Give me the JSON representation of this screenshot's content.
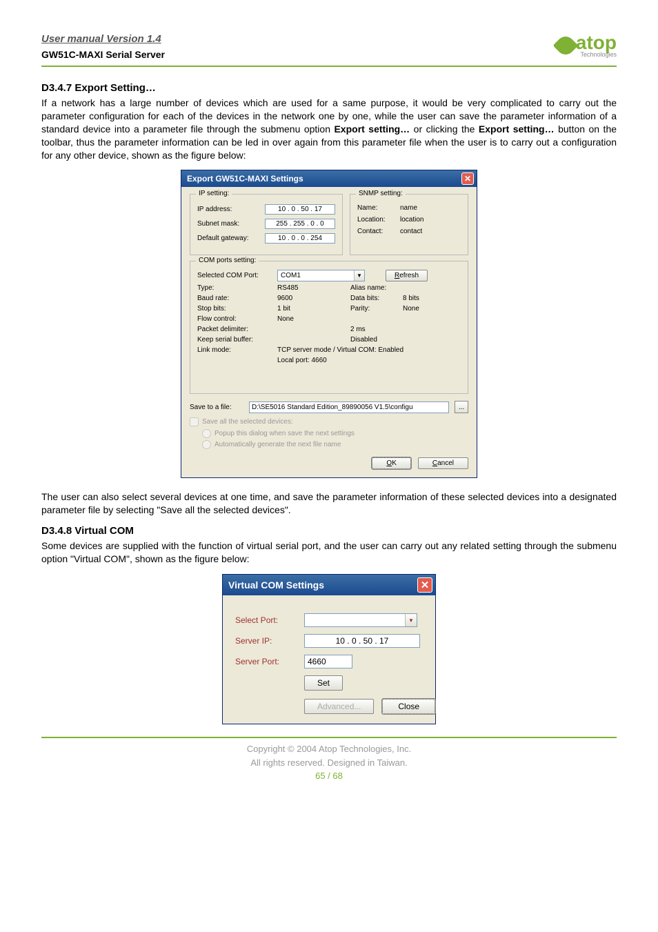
{
  "header": {
    "manual_title": "User manual Version 1.4",
    "product": "GW51C-MAXI Serial Server",
    "logo_text": "atop",
    "logo_sub": "Technologies"
  },
  "section1": {
    "heading": "D3.4.7 Export Setting…",
    "para_a": "If a network has a large number of devices which are used for a same purpose, it would be very complicated to carry out the parameter configuration for each of the devices in the network one by one, while the user can save the parameter information of a standard device into a parameter file through the submenu option ",
    "bold1": "Export setting…",
    "para_b": " or clicking the ",
    "bold2": "Export setting…",
    "para_c": " button on the toolbar, thus the parameter information can be led in over again from this parameter file when the user is to carry out a configuration for any other device, shown as the figure below:"
  },
  "dialog_export": {
    "title": "Export GW51C-MAXI Settings",
    "ip_group": "IP setting:",
    "ip_addr_label": "IP address:",
    "ip_addr": "10  .  0  . 50 . 17",
    "subnet_label": "Subnet mask:",
    "subnet": "255 . 255 .  0  .  0",
    "gateway_label": "Default gateway:",
    "gateway": "10  .  0  .  0  . 254",
    "snmp_group": "SNMP setting:",
    "snmp_name_label": "Name:",
    "snmp_name": "name",
    "snmp_loc_label": "Location:",
    "snmp_loc": "location",
    "snmp_contact_label": "Contact:",
    "snmp_contact": "contact",
    "com_group": "COM ports setting:",
    "sel_com_label": "Selected COM Port:",
    "sel_com": "COM1",
    "refresh": "Refresh",
    "refresh_ul": "R",
    "type_label": "Type:",
    "type_val": "RS485",
    "alias_label": "Alias name:",
    "alias_val": "",
    "baud_label": "Baud rate:",
    "baud_val": "9600",
    "databits_label": "Data bits:",
    "databits_val": "8 bits",
    "stopbits_label": "Stop bits:",
    "stopbits_val": "1 bit",
    "parity_label": "Parity:",
    "parity_val": "None",
    "flow_label": "Flow control:",
    "flow_val": "None",
    "pkt_label": "Packet delimiter:",
    "pkt_val": "2 ms",
    "keep_label": "Keep serial buffer:",
    "keep_val": "Disabled",
    "link_label": "Link mode:",
    "link_val": "TCP server mode / Virtual COM: Enabled",
    "local_port": "Local port: 4660",
    "save_label": "Save to a file:",
    "save_path": "D:\\SE5016 Standard Edition_89890056 V1.5\\configu",
    "browse": "...",
    "save_all": "Save all the selected devices:",
    "popup_radio": "Popup this dialog when save the next settings",
    "auto_radio": "Automatically generate the next file name",
    "ok": "OK",
    "ok_ul": "O",
    "cancel": "Cancel",
    "cancel_ul": "C"
  },
  "between_para": "The user can also select several devices at one time, and save the parameter information of these selected devices into a designated parameter file by selecting \"Save all the selected devices\".",
  "section2": {
    "heading": "D3.4.8 Virtual COM",
    "para": "Some devices are supplied with the function of virtual serial port, and the user can carry out any related setting through the submenu option \"Virtual COM\", shown as the figure below:"
  },
  "dialog_vcom": {
    "title": "Virtual COM Settings",
    "select_port": "Select Port:",
    "server_ip_label": "Server IP:",
    "server_ip": "10   .    0   .   50   .   17",
    "server_port_label": "Server Port:",
    "server_port": "4660",
    "set": "Set",
    "advanced": "Advanced...",
    "close": "Close"
  },
  "footer": {
    "copyright": "Copyright © 2004 Atop Technologies, Inc.",
    "rights": "All rights reserved. Designed in Taiwan.",
    "page": "65 / 68"
  }
}
